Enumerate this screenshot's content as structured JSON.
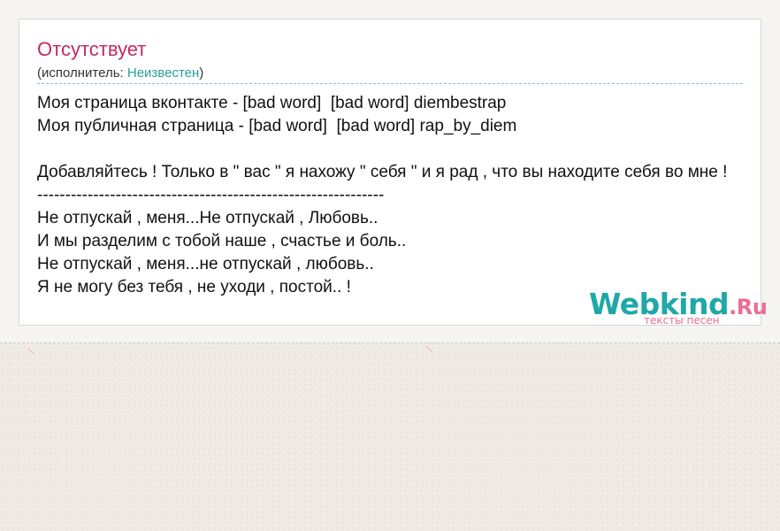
{
  "song": {
    "title": "Отсутствует",
    "artist_prefix": "(исполнитель: ",
    "artist_name": "Неизвестен",
    "artist_suffix": ")"
  },
  "lyrics": [
    "Моя страница вконтакте - [bad word]  [bad word] diembestrap",
    "Моя публичная страница - [bad word]  [bad word] rap_by_diem",
    "",
    "Добавляйтесь ! Только в \" вас \" я нахожу \" себя \" и я рад , что вы находите себя во мне !",
    "--------------------------------------------------------------",
    "Не отпускай , меня...Не отпускай , Любовь..",
    "И мы разделим с тобой наше , счастье и боль..",
    "Не отпускай , меня...не отпускай , любовь..",
    "Я не могу без тебя , не уходи , постой.. !"
  ],
  "watermark": {
    "brand": "Webkind",
    "tld": ".Ru",
    "tagline": "тексты песен"
  },
  "colors": {
    "title": "#c22a5a",
    "link": "#2a9d9d",
    "brand": "#1fa8a8",
    "brand_accent": "#e86f94"
  }
}
